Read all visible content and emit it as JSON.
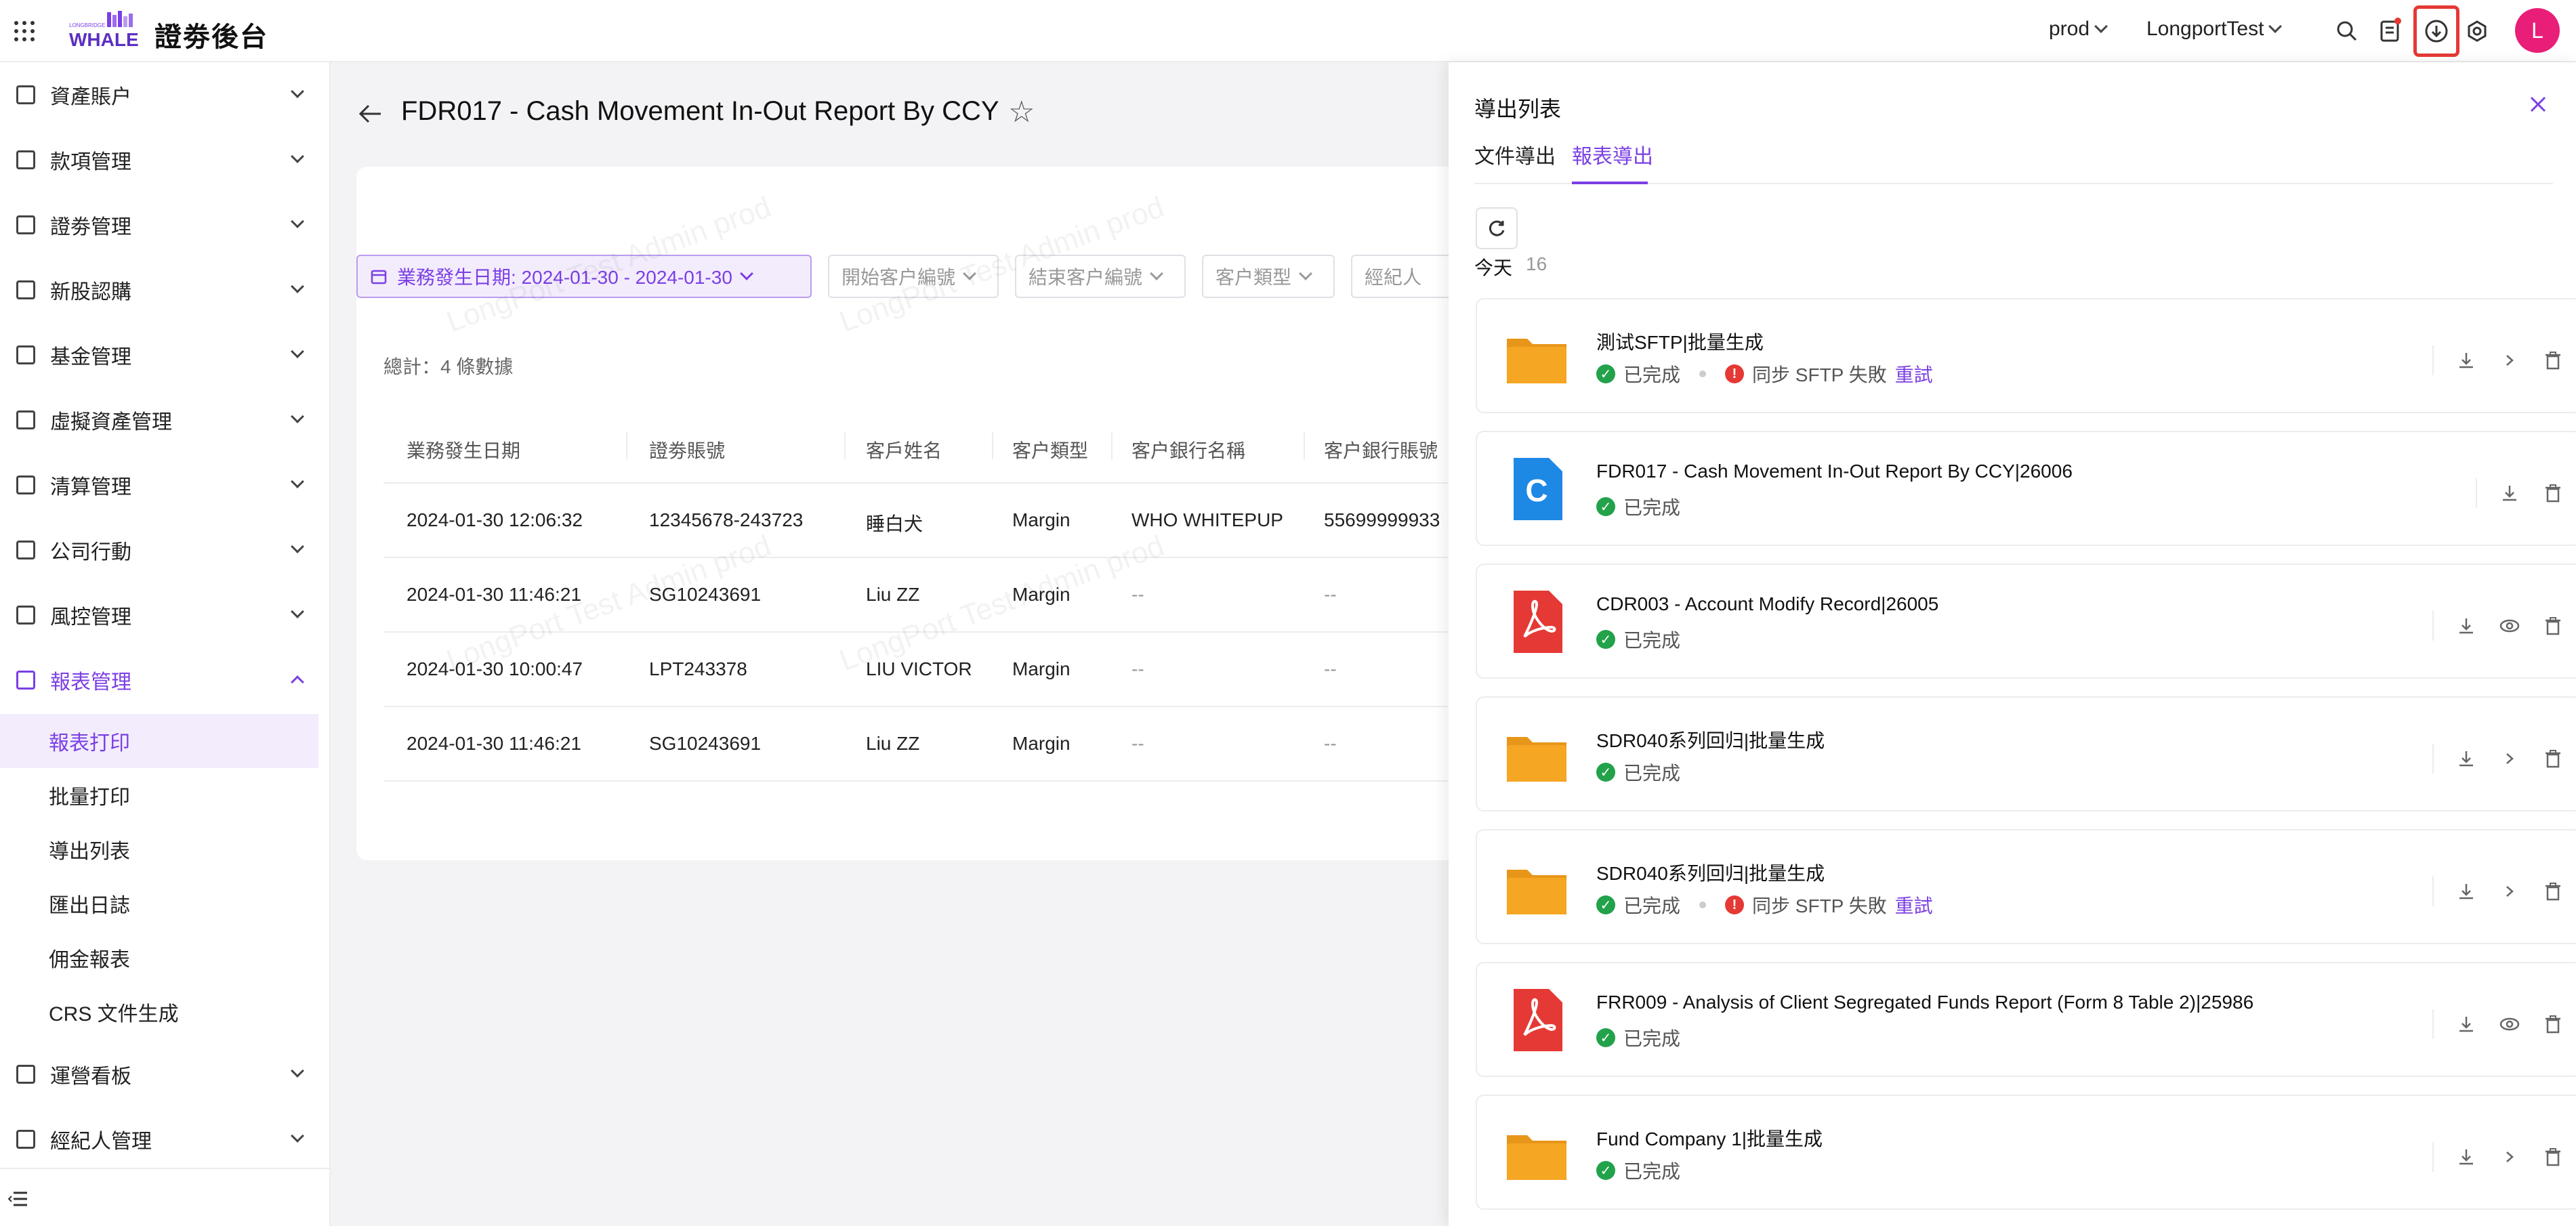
{
  "app": {
    "title": "證劵後台",
    "logo_small": "LONGBRIDGE",
    "logo_text": "WHALE",
    "env": "prod",
    "account": "LongportTest",
    "avatar_letter": "L"
  },
  "sidebar": {
    "items": [
      {
        "label": "資產賬户"
      },
      {
        "label": "款項管理"
      },
      {
        "label": "證劵管理"
      },
      {
        "label": "新股認購"
      },
      {
        "label": "基金管理"
      },
      {
        "label": "虛擬資產管理"
      },
      {
        "label": "清算管理"
      },
      {
        "label": "公司行動"
      },
      {
        "label": "風控管理"
      },
      {
        "label": "報表管理"
      },
      {
        "label": "運營看板"
      },
      {
        "label": "經紀人管理"
      }
    ],
    "sub_items": [
      {
        "label": "報表打印"
      },
      {
        "label": "批量打印"
      },
      {
        "label": "導出列表"
      },
      {
        "label": "匯出日誌"
      },
      {
        "label": "佣金報表"
      },
      {
        "label": "CRS 文件生成"
      }
    ]
  },
  "main": {
    "title": "FDR017 - Cash Movement In-Out Report By CCY",
    "filters": {
      "date": "業務發生日期: 2024-01-30 - 2024-01-30",
      "start_client": "開始客户編號",
      "end_client": "結束客户編號",
      "client_type": "客户類型",
      "broker": "經紀人"
    },
    "total": "總計：4 條數據",
    "columns": [
      "業務發生日期",
      "證劵賬號",
      "客戶姓名",
      "客户類型",
      "客户銀行名稱",
      "客户銀行賬號"
    ],
    "rows": [
      [
        "2024-01-30 12:06:32",
        "12345678-243723",
        "睡白犬",
        "Margin",
        "WHO WHITEPUP",
        "55699999933"
      ],
      [
        "2024-01-30 11:46:21",
        "SG10243691",
        "Liu ZZ",
        "Margin",
        "--",
        "--"
      ],
      [
        "2024-01-30 10:00:47",
        "LPT243378",
        "LIU VICTOR",
        "Margin",
        "--",
        "--"
      ],
      [
        "2024-01-30 11:46:21",
        "SG10243691",
        "Liu ZZ",
        "Margin",
        "--",
        "--"
      ]
    ],
    "watermark": "LongPort Test Admin prod"
  },
  "drawer": {
    "title": "導出列表",
    "tabs": [
      {
        "label": "文件導出"
      },
      {
        "label": "報表導出"
      }
    ],
    "today_label": "今天",
    "today_count": "16",
    "items": [
      {
        "name": "測试SFTP|批量生成",
        "icon": "folder-icon",
        "status": "已完成",
        "error": "同步 SFTP 失敗",
        "retry": "重試"
      },
      {
        "name": "FDR017 - Cash Movement In-Out Report By CCY|26006",
        "icon": "csv-file-icon",
        "icon_letter": "C",
        "status": "已完成"
      },
      {
        "name": "CDR003 - Account Modify Record|26005",
        "icon": "pdf-file-icon",
        "status": "已完成"
      },
      {
        "name": "SDR040系列回归|批量生成",
        "icon": "folder-icon",
        "status": "已完成"
      },
      {
        "name": "SDR040系列回归|批量生成",
        "icon": "folder-icon",
        "status": "已完成",
        "error": "同步 SFTP 失敗",
        "retry": "重試"
      },
      {
        "name": "FRR009 - Analysis of Client Segregated Funds Report (Form 8 Table 2)|25986",
        "icon": "pdf-file-icon",
        "status": "已完成"
      },
      {
        "name": "Fund Company 1|批量生成",
        "icon": "folder-icon",
        "status": "已完成"
      }
    ]
  },
  "colors": {
    "accent": "#7b3fe4",
    "success": "#22a24a",
    "error": "#e53935",
    "folder": "#f5a623",
    "pdf": "#e53935",
    "csv": "#1e88e5"
  }
}
